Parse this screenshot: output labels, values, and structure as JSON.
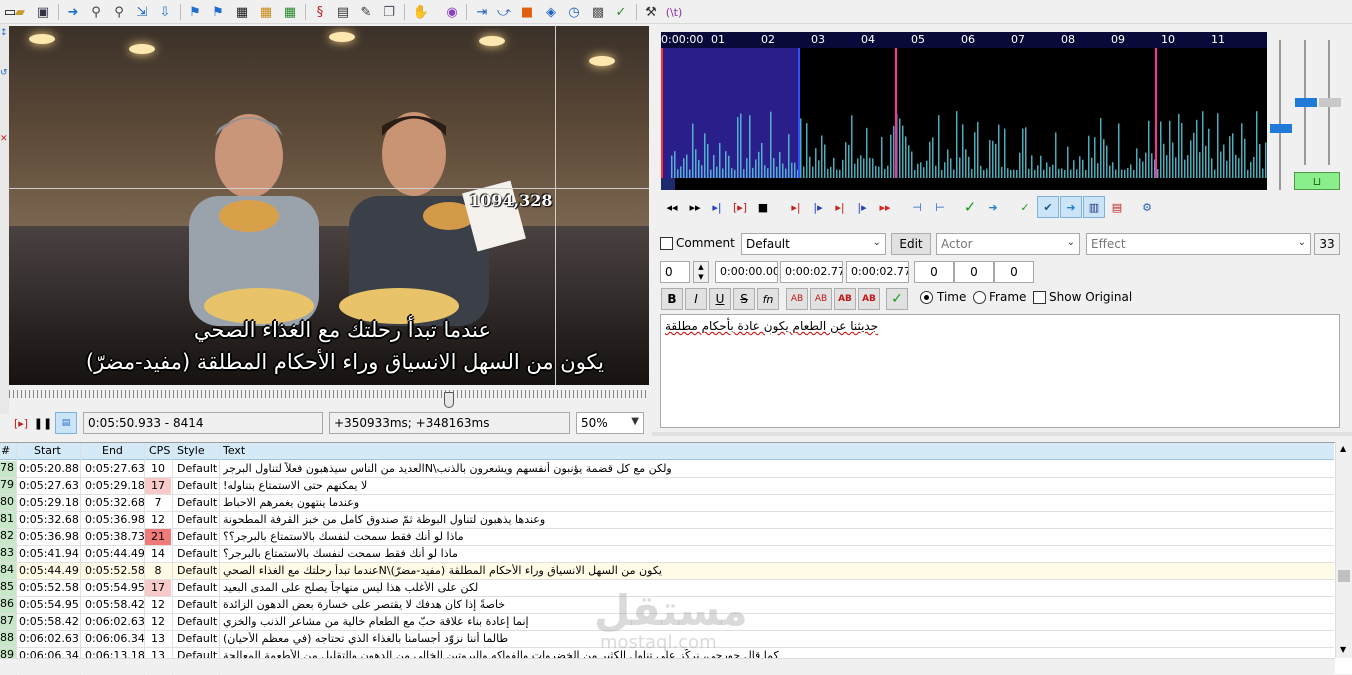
{
  "toolbar": {
    "icons": [
      "new-file-icon",
      "open-folder-icon",
      "save-icon",
      "jump-to-icon",
      "zoom-in-icon",
      "zoom-out-icon",
      "attach-icon",
      "fonts-icon",
      "styles-icon",
      "styles-manager-icon",
      "properties-icon",
      "attachments-icon",
      "video-icon",
      "audio-icon",
      "script-icon",
      "translate-icon",
      "spell-check-icon",
      "shift-times-icon",
      "resample-icon",
      "timing-post-processor-icon",
      "kanji-timer-icon",
      "clock-icon",
      "select-lines-icon",
      "tool-icon",
      "hammer-icon",
      "regex-icon"
    ],
    "regex_label": "(\\t)"
  },
  "video": {
    "coordinate": "1094,328",
    "subtitle_line1": "عندما تبدأ رحلتك مع الغذاء الصحي",
    "subtitle_line2": "يكون من السهل الانسياق وراء الأحكام المطلقة (مفيد-مضرّ)",
    "time_display": "0:05:50.933 - 8414",
    "offset_display": "+350933ms; +348163ms",
    "zoom": "50%",
    "seek_fraction": 0.69
  },
  "audio": {
    "ruler_labels": [
      "0:00:00",
      "01",
      "02",
      "03",
      "04",
      "05",
      "06",
      "07",
      "08",
      "09",
      "10",
      "11"
    ],
    "selection_color": "#2a1f8a",
    "marker_color": "#ff2f9f"
  },
  "edit": {
    "comment_label": "Comment",
    "style": "Default",
    "edit_button": "Edit",
    "actor_placeholder": "Actor",
    "effect_placeholder": "Effect",
    "char_count": "33",
    "layer": "0",
    "start_time": "0:00:00.00",
    "end_time": "0:00:02.77",
    "duration": "0:00:02.77",
    "margin_left": "0",
    "margin_right": "0",
    "margin_vert": "0",
    "time_label": "Time",
    "frame_label": "Frame",
    "show_original_label": "Show Original",
    "format_buttons": [
      "B",
      "I",
      "U",
      "S",
      "fn",
      "AB",
      "AB",
      "AB",
      "AB"
    ],
    "text": "جديثنا عن الطعام يكون عادة بأحكام مطلقة"
  },
  "grid": {
    "headers": {
      "num": "#",
      "start": "Start",
      "end": "End",
      "cps": "CPS",
      "style": "Style",
      "text": "Text"
    },
    "rows": [
      {
        "num": "78",
        "start": "0:05:20.88",
        "end": "0:05:27.63",
        "cps": "10",
        "style": "Default",
        "text": "ولكن مع كل قضمة يؤنبون أنفسهم ويشعرون بالذنب\\Nالعديد من الناس سيذهبون فعلاً لتناول البرجر",
        "warn": 0
      },
      {
        "num": "79",
        "start": "0:05:27.63",
        "end": "0:05:29.18",
        "cps": "17",
        "style": "Default",
        "text": "لا يمكنهم حتى الاستمتاع بتناوله!",
        "warn": 1
      },
      {
        "num": "80",
        "start": "0:05:29.18",
        "end": "0:05:32.68",
        "cps": "7",
        "style": "Default",
        "text": "وعندما ينتهون يغمرهم الاحباط",
        "warn": 0
      },
      {
        "num": "81",
        "start": "0:05:32.68",
        "end": "0:05:36.98",
        "cps": "12",
        "style": "Default",
        "text": "وعندها يذهبون لتناول البوظة ثمّ صندوق كامل من خبز القرفة المطحونة",
        "warn": 0
      },
      {
        "num": "82",
        "start": "0:05:36.98",
        "end": "0:05:38.73",
        "cps": "21",
        "style": "Default",
        "text": "ماذا لو أنك فقط سمحت لنفسك بالاستمتاع بالبرجر؟؟",
        "warn": 2
      },
      {
        "num": "83",
        "start": "0:05:41.94",
        "end": "0:05:44.49",
        "cps": "14",
        "style": "Default",
        "text": "ماذا لو أنك فقط سمحت لنفسك بالاستمتاع بالبرجر؟",
        "warn": 0
      },
      {
        "num": "84",
        "start": "0:05:44.49",
        "end": "0:05:52.58",
        "cps": "8",
        "style": "Default",
        "text": "يكون من السهل الانسياق وراء الأحكام المطلقة (مفيد-مضرّ)\\Nعندما تبدأ رحلتك مع الغذاء الصحي",
        "warn": 0,
        "active": true
      },
      {
        "num": "85",
        "start": "0:05:52.58",
        "end": "0:05:54.95",
        "cps": "17",
        "style": "Default",
        "text": "لكن على الأغلب هذا ليس منهاجاً يصلح على المدى البعيد",
        "warn": 1
      },
      {
        "num": "86",
        "start": "0:05:54.95",
        "end": "0:05:58.42",
        "cps": "12",
        "style": "Default",
        "text": "خاصةً إذا كان هدفك لا يقتصر على خسارة بعض الدهون الزائدة",
        "warn": 0
      },
      {
        "num": "87",
        "start": "0:05:58.42",
        "end": "0:06:02.63",
        "cps": "12",
        "style": "Default",
        "text": "إنما إعادة بناء علاقة حبّ مع الطعام خالية من مشاعر الذنب والخزي",
        "warn": 0
      },
      {
        "num": "88",
        "start": "0:06:02.63",
        "end": "0:06:06.34",
        "cps": "13",
        "style": "Default",
        "text": "طالما أننا نزوّد أجسامنا بالغذاء الذي تحتاجه (في معظم الأحيان)",
        "warn": 0
      },
      {
        "num": "89",
        "start": "0:06:06.34",
        "end": "0:06:13.18",
        "cps": "13",
        "style": "Default",
        "text": "كما قال جورجي، نركّز على تناول الكثير من الخضروات والفواكه والبروتين الخالي من الدهون والتقليل من الأطعمة المعالجة",
        "warn": 0
      }
    ]
  },
  "watermark": {
    "text": "مستقل",
    "sub": "mostaql.com"
  }
}
